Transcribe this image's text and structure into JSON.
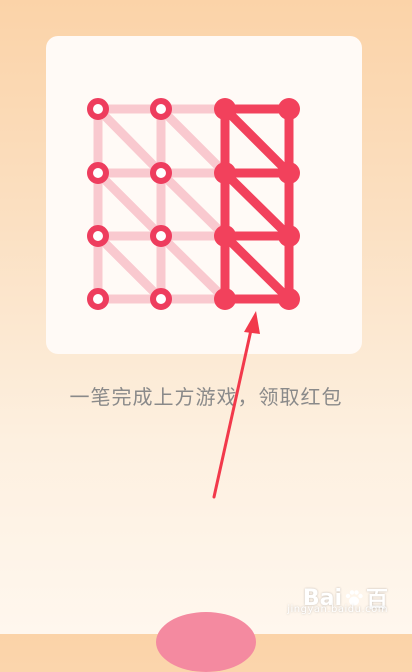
{
  "game": {
    "instruction": "一笔完成上方游戏，领取红包",
    "colors": {
      "faded_line": "#f9c9cf",
      "active_line": "#f2415c",
      "node": "#ee3d5e"
    }
  },
  "watermark": {
    "brand": "Bai",
    "brand_suffix": "百",
    "site": "jingyan.baidu.com"
  },
  "annotation": {
    "arrow_color": "#f2394b"
  },
  "icons": {
    "watermark_icon": "paw-icon"
  }
}
